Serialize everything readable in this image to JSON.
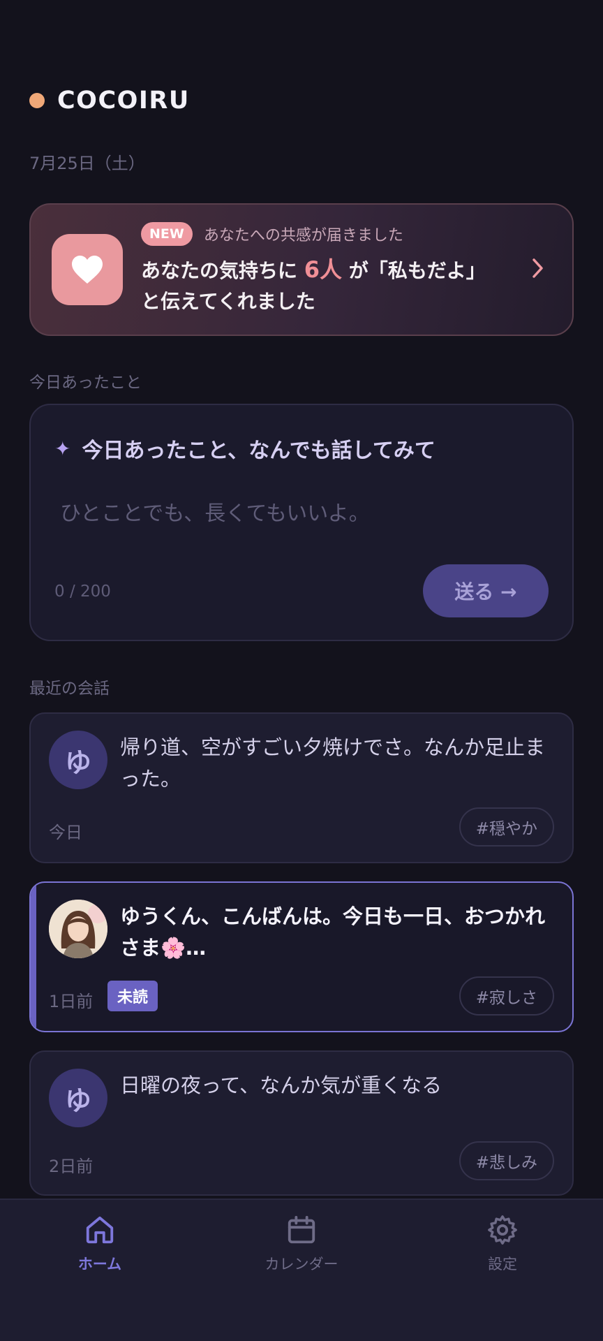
{
  "app": {
    "brand": "COCOIRU",
    "date": "7月25日（土）",
    "accent_color": "#f0a878"
  },
  "empathy": {
    "badge": "NEW",
    "subtitle": "あなたへの共感が届きました",
    "line1_prefix": "あなたの気持ちに",
    "count": "6人",
    "line1_suffix": "が「私もだよ」",
    "line2": "と伝えてくれました",
    "icon": "heart-icon"
  },
  "compose": {
    "section_label": "今日あったこと",
    "title": "今日あったこと、なんでも話してみて",
    "placeholder": "ひとことでも、長くてもいいよ。",
    "counter": "0 / 200",
    "send_label": "送る →"
  },
  "recent": {
    "section_label": "最近の会話",
    "items": [
      {
        "avatar_initial": "ゆ",
        "text": "帰り道、空がすごい夕焼けでさ。なんか足止まった。",
        "time": "今日",
        "tag": "#穏やか",
        "unread": false
      },
      {
        "avatar_initial": "",
        "text": "ゆうくん、こんばんは。今日も一日、おつかれさま🌸…",
        "time": "1日前",
        "unread_label": "未読",
        "tag": "#寂しさ",
        "unread": true
      },
      {
        "avatar_initial": "ゆ",
        "text": "日曜の夜って、なんか気が重くなる",
        "time": "2日前",
        "tag": "#悲しみ",
        "unread": false
      }
    ]
  },
  "tabs": [
    {
      "label": "ホーム",
      "icon": "home-icon",
      "active": true
    },
    {
      "label": "カレンダー",
      "icon": "calendar-icon",
      "active": false
    },
    {
      "label": "設定",
      "icon": "gear-icon",
      "active": false
    }
  ]
}
